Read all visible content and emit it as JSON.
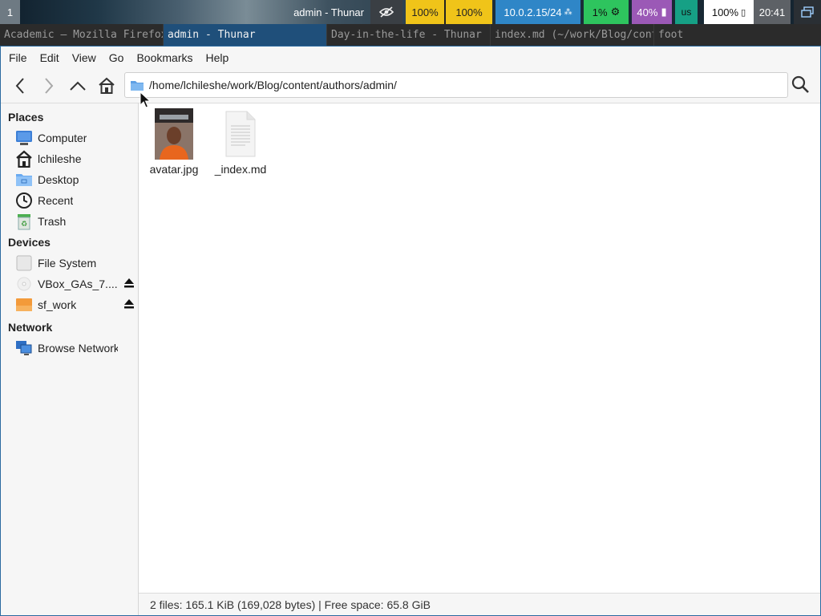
{
  "statusbar": {
    "workspace": "1",
    "window_title": "admin - Thunar",
    "brightness": "100%",
    "volume": "100%",
    "network": "10.0.2.15/24",
    "cpu": "1%",
    "memory": "40%",
    "keyboard_layout": "us",
    "battery": "100%",
    "clock": "20:41",
    "colors": {
      "brightness": "#f0c419",
      "network": "#2f86c7",
      "cpu": "#2ec45e",
      "memory": "#9b59b6",
      "keyboard": "#16a085"
    }
  },
  "window_tabs": [
    {
      "label": "Academic — Mozilla Firefox",
      "active": false
    },
    {
      "label": "admin - Thunar",
      "active": true
    },
    {
      "label": "Day-in-the-life - Thunar",
      "active": false
    },
    {
      "label": "index.md (~/work/Blog/content/authors/admin)",
      "active": false
    },
    {
      "label": "foot",
      "active": false
    }
  ],
  "menubar": [
    "File",
    "Edit",
    "View",
    "Go",
    "Bookmarks",
    "Help"
  ],
  "toolbar": {
    "back_icon": "back-arrow-icon",
    "forward_icon": "forward-arrow-icon",
    "up_icon": "parent-folder-icon",
    "home_icon": "home-icon",
    "location": "/home/lchileshe/work/Blog/content/authors/admin/",
    "search_icon": "search-icon"
  },
  "sidebar": {
    "places_title": "Places",
    "places": [
      {
        "label": "Computer",
        "icon": "computer-icon"
      },
      {
        "label": "lchileshe",
        "icon": "home-folder-icon"
      },
      {
        "label": "Desktop",
        "icon": "desktop-folder-icon"
      },
      {
        "label": "Recent",
        "icon": "recent-clock-icon"
      },
      {
        "label": "Trash",
        "icon": "trash-icon"
      }
    ],
    "devices_title": "Devices",
    "devices": [
      {
        "label": "File System",
        "icon": "drive-icon"
      },
      {
        "label": "VBox_GAs_7....",
        "icon": "optical-disc-icon"
      },
      {
        "label": "sf_work",
        "icon": "shared-folder-icon"
      }
    ],
    "network_title": "Network",
    "network": [
      {
        "label": "Browse Network",
        "icon": "network-icon"
      }
    ]
  },
  "files": [
    {
      "name": "avatar.jpg",
      "icon": "image-thumbnail-icon"
    },
    {
      "name": "_index.md",
      "icon": "text-document-icon"
    }
  ],
  "statusline": "2 files: 165.1 KiB (169,028 bytes)  |  Free space: 65.8 GiB"
}
